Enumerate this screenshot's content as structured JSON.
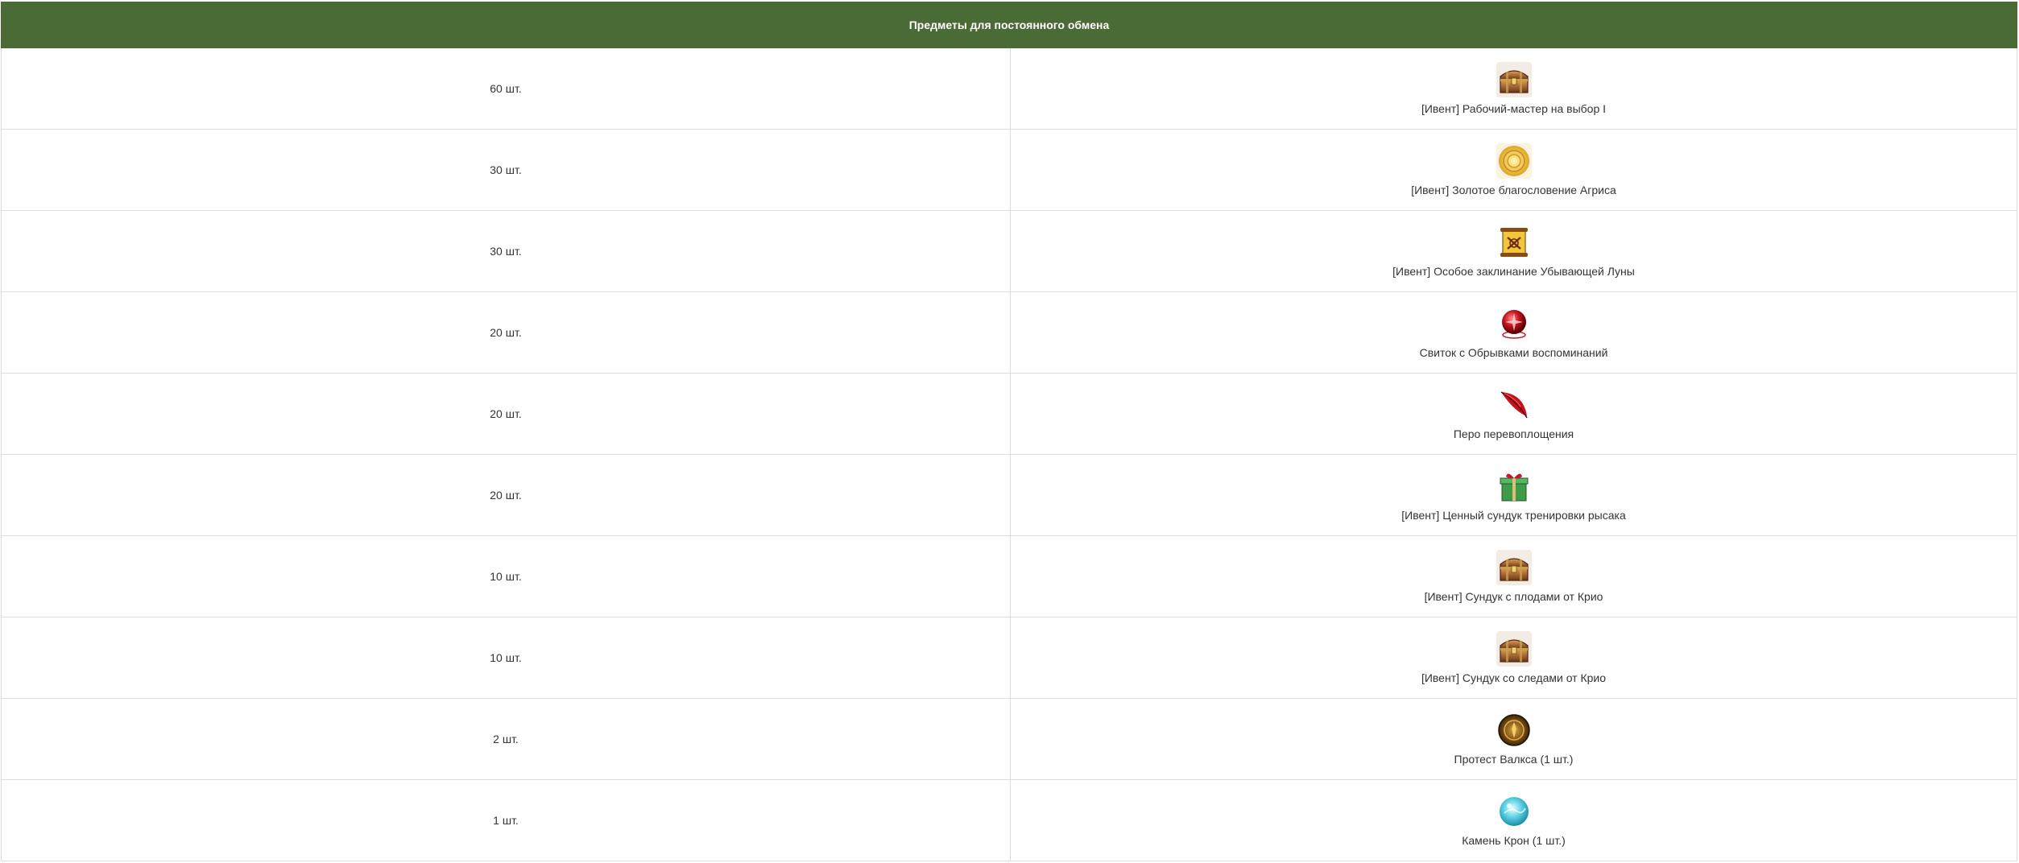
{
  "table": {
    "header": "Предметы для постоянного обмена",
    "rows": [
      {
        "quantity": "60 шт.",
        "item": "[Ивент] Рабочий-мастер на выбор I",
        "icon": "treasure-chest-icon"
      },
      {
        "quantity": "30 шт.",
        "item": "[Ивент] Золотое благословение Агриса",
        "icon": "golden-blessing-icon"
      },
      {
        "quantity": "30 шт.",
        "item": "[Ивент] Особое заклинание Убывающей Луны",
        "icon": "scroll-icon"
      },
      {
        "quantity": "20 шт.",
        "item": "Свиток с Обрывками воспоминаний",
        "icon": "red-orb-icon"
      },
      {
        "quantity": "20 шт.",
        "item": "Перо перевоплощения",
        "icon": "feather-icon"
      },
      {
        "quantity": "20 шт.",
        "item": "[Ивент] Ценный сундук тренировки рысака",
        "icon": "gift-box-icon"
      },
      {
        "quantity": "10 шт.",
        "item": "[Ивент] Сундук с плодами от Крио",
        "icon": "treasure-chest-icon"
      },
      {
        "quantity": "10 шт.",
        "item": "[Ивент] Сундук со следами от Крио",
        "icon": "treasure-chest-icon"
      },
      {
        "quantity": "2 шт.",
        "item": "Протест Валкса (1 шт.)",
        "icon": "medallion-icon"
      },
      {
        "quantity": "1 шт.",
        "item": "Камень Крон (1 шт.)",
        "icon": "blue-stone-icon"
      }
    ]
  },
  "colors": {
    "header_bg": "#4a6a36",
    "header_text": "#ffffff",
    "border": "#dcdcdc",
    "text": "#333333"
  }
}
